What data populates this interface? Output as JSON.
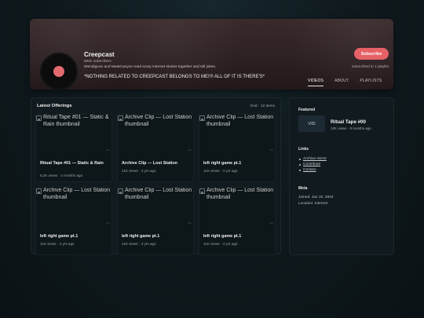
{
  "channel": {
    "name": "Creepcast",
    "subscribers": "894K subscribers",
    "description": "Wendigoon and MeatCanyon read scary internet stories together and tell jokes.",
    "notice": "*NOTHING RELATED TO CREEPCAST BELONGS TO ME!!!! ALL OF IT IS THERE'S*",
    "subscribe_label": "Subscribe",
    "subscribed_note": "Subscribed to 1 playlist",
    "accent_color": "#e56166"
  },
  "tabs": [
    {
      "label": "VIDEOS",
      "active": true
    },
    {
      "label": "ABOUT",
      "active": false
    },
    {
      "label": "PLAYLISTS",
      "active": false
    }
  ],
  "main": {
    "title": "Latest Offerings",
    "meta": "Grid · 12 items",
    "cards": [
      {
        "thumb_alt": "Ritual Tape #01 — Static & Rain thumbnail",
        "title": "Ritual Tape #01 — Static & Rain",
        "meta": "5.2K views · 2 months ago"
      },
      {
        "thumb_alt": "Archive Clip — Lost Station thumbnail",
        "title": "Archive Clip — Lost Station",
        "meta": "11K views · 4 yrs ago"
      },
      {
        "thumb_alt": "Archive Clip — Lost Station thumbnail",
        "title": "left right game pt.1",
        "meta": "11K views · 4 yrs ago"
      },
      {
        "thumb_alt": "Archive Clip — Lost Station thumbnail",
        "title": "left right game pt.1",
        "meta": "11K views · 4 yrs ago"
      },
      {
        "thumb_alt": "Archive Clip — Lost Station thumbnail",
        "title": "left right game pt.1",
        "meta": "11K views · 4 yrs ago"
      },
      {
        "thumb_alt": "Archive Clip — Lost Station thumbnail",
        "title": "left right game pt.1",
        "meta": "11K views · 4 yrs ago"
      }
    ]
  },
  "sidebar": {
    "featured_heading": "Featured",
    "featured_thumb_label": "VID",
    "featured_title": "Ritual Tape #00",
    "featured_meta": "12K views · 9 months ago",
    "links_heading": "Links",
    "links": [
      "Archive mirror",
      "Contribute",
      "Contact"
    ],
    "meta_heading": "Meta",
    "joined": "Joined: Jan 10, 2004",
    "location": "Location: Internet"
  }
}
